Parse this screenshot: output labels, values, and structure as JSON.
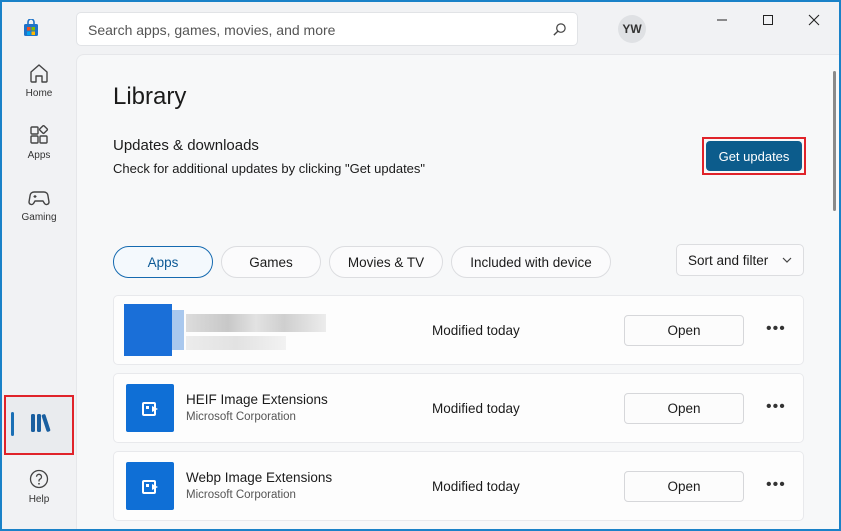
{
  "search": {
    "placeholder": "Search apps, games, movies, and more"
  },
  "user": {
    "initials": "YW"
  },
  "sidebar": {
    "items": [
      {
        "label": "Home",
        "icon": "home-icon"
      },
      {
        "label": "Apps",
        "icon": "apps-icon"
      },
      {
        "label": "Gaming",
        "icon": "gaming-icon"
      },
      {
        "label": "",
        "icon": "library-icon"
      },
      {
        "label": "Help",
        "icon": "help-icon"
      }
    ]
  },
  "main": {
    "title": "Library",
    "updates_title": "Updates & downloads",
    "updates_desc": "Check for additional updates by clicking \"Get updates\"",
    "get_updates_label": "Get updates",
    "filters": [
      "Apps",
      "Games",
      "Movies & TV",
      "Included with device"
    ],
    "active_filter": "Apps",
    "sort_label": "Sort and filter",
    "apps": [
      {
        "name": "",
        "publisher": "",
        "status": "Modified today",
        "action": "Open",
        "blurred": true
      },
      {
        "name": "HEIF Image Extensions",
        "publisher": "Microsoft Corporation",
        "status": "Modified today",
        "action": "Open",
        "blurred": false
      },
      {
        "name": "Webp Image Extensions",
        "publisher": "Microsoft Corporation",
        "status": "Modified today",
        "action": "Open",
        "blurred": false
      }
    ],
    "more_label": "•••"
  },
  "colors": {
    "accent": "#0c5c8c",
    "highlight": "#e0232a",
    "app_icon": "#0f6fd6",
    "frame": "#1a82c8"
  }
}
